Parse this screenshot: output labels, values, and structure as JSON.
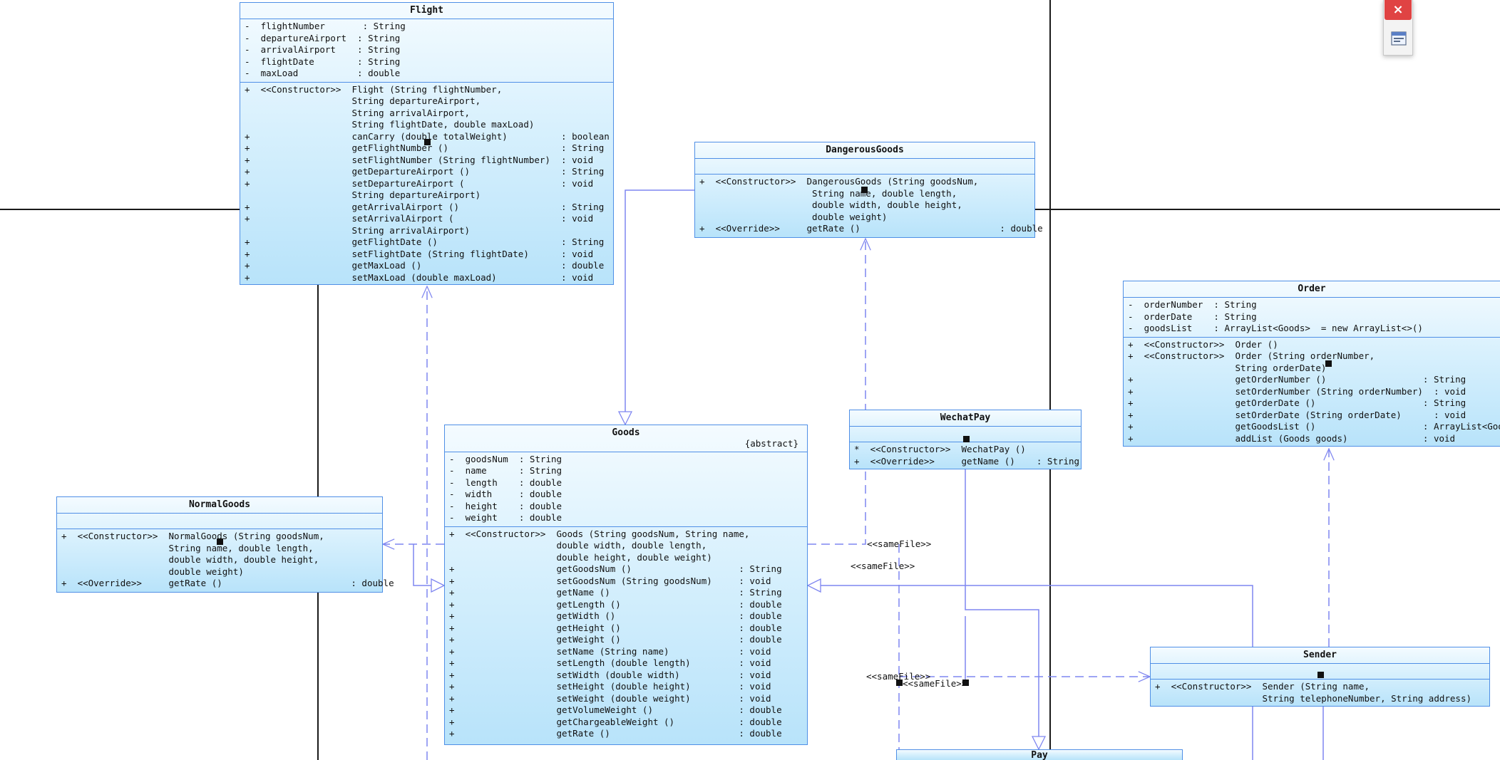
{
  "toolbar": {
    "close_symbol": "×",
    "palette_icon": "diagram-palette-icon"
  },
  "colors": {
    "class_border": "#4f8fe6",
    "link": "#7f86f0",
    "frame": "#1a1a1a",
    "close": "#e04343"
  },
  "classes": {
    "flight": {
      "name": "Flight",
      "attributes": [
        "-  flightNumber       : String",
        "-  departureAirport  : String",
        "-  arrivalAirport    : String",
        "-  flightDate        : String",
        "-  maxLoad           : double"
      ],
      "operations": [
        "+  <<Constructor>>  Flight (String flightNumber,",
        "                    String departureAirport,",
        "                    String arrivalAirport,",
        "                    String flightDate, double maxLoad)",
        "+                   canCarry (double totalWeight)          : boolean",
        "+                   getFlightNumber ()                     : String",
        "+                   setFlightNumber (String flightNumber)  : void",
        "+                   getDepartureAirport ()                 : String",
        "+                   setDepartureAirport (                  : void",
        "                    String departureAirport)",
        "+                   getArrivalAirport ()                   : String",
        "+                   setArrivalAirport (                    : void",
        "                    String arrivalAirport)",
        "+                   getFlightDate ()                       : String",
        "+                   setFlightDate (String flightDate)      : void",
        "+                   getMaxLoad ()                          : double",
        "+                   setMaxLoad (double maxLoad)            : void"
      ]
    },
    "dangerous_goods": {
      "name": "DangerousGoods",
      "attributes": [],
      "operations": [
        "+  <<Constructor>>  DangerousGoods (String goodsNum,",
        "                     String name, double length,",
        "                     double width, double height,",
        "                     double weight)",
        "+  <<Override>>     getRate ()                          : double"
      ]
    },
    "goods": {
      "name": "Goods",
      "stereotype": "{abstract}",
      "attributes": [
        "-  goodsNum  : String",
        "-  name      : String",
        "-  length    : double",
        "-  width     : double",
        "-  height    : double",
        "-  weight    : double"
      ],
      "operations": [
        "+  <<Constructor>>  Goods (String goodsNum, String name,",
        "                    double width, double length,",
        "                    double height, double weight)",
        "+                   getGoodsNum ()                    : String",
        "+                   setGoodsNum (String goodsNum)     : void",
        "+                   getName ()                        : String",
        "+                   getLength ()                      : double",
        "+                   getWidth ()                       : double",
        "+                   getHeight ()                      : double",
        "+                   getWeight ()                      : double",
        "+                   setName (String name)             : void",
        "+                   setLength (double length)         : void",
        "+                   setWidth (double width)           : void",
        "+                   setHeight (double height)         : void",
        "+                   setWeight (double weight)         : void",
        "+                   getVolumeWeight ()                : double",
        "+                   getChargeableWeight ()            : double",
        "+                   getRate ()                        : double"
      ]
    },
    "normal_goods": {
      "name": "NormalGoods",
      "attributes": [],
      "operations": [
        "+  <<Constructor>>  NormalGoods (String goodsNum,",
        "                    String name, double length,",
        "                    double width, double height,",
        "                    double weight)",
        "+  <<Override>>     getRate ()                        : double"
      ]
    },
    "wechat_pay": {
      "name": "WechatPay",
      "attributes": [],
      "operations": [
        "*  <<Constructor>>  WechatPay ()",
        "+  <<Override>>     getName ()    : String"
      ]
    },
    "order": {
      "name": "Order",
      "attributes": [
        "-  orderNumber  : String",
        "-  orderDate    : String",
        "-  goodsList    : ArrayList<Goods>  = new ArrayList<>()"
      ],
      "operations": [
        "+  <<Constructor>>  Order ()",
        "+  <<Constructor>>  Order (String orderNumber,",
        "                    String orderDate)",
        "+                   getOrderNumber ()                  : String",
        "+                   setOrderNumber (String orderNumber)  : void",
        "+                   getOrderDate ()                    : String",
        "+                   setOrderDate (String orderDate)      : void",
        "+                   getGoodsList ()                    : ArrayList<Goods>",
        "+                   addList (Goods goods)              : void"
      ]
    },
    "sender": {
      "name": "Sender",
      "attributes": [],
      "operations": [
        "+  <<Constructor>>  Sender (String name,",
        "                    String telephoneNumber, String address)"
      ]
    },
    "pay": {
      "name": "Pay"
    }
  },
  "link_labels": {
    "samefile_1": "<<sameFile>>",
    "samefile_2": "<<sameFile>>",
    "samefile_3": "<<sameFile>>",
    "samefile_4": "<<sameFile>>"
  }
}
